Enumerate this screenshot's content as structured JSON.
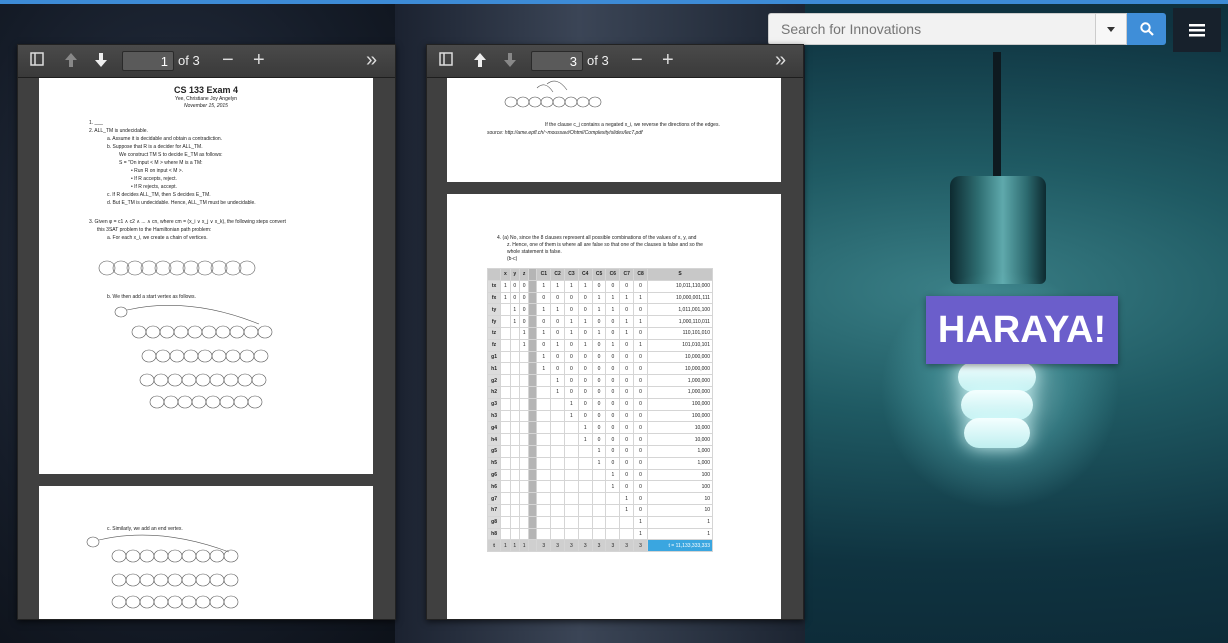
{
  "search": {
    "placeholder": "Search for Innovations"
  },
  "logo": {
    "text": "HARAYA!"
  },
  "viewer_left": {
    "page": "1",
    "of": "of 3"
  },
  "viewer_right": {
    "page": "3",
    "of": "of 3"
  },
  "doc_p1": {
    "title": "CS 133 Exam 4",
    "author": "Yee, Christiane Joy Angelyn",
    "date": "November 15, 2015",
    "lines": [
      "1.  ___",
      "2.  ALL_TM is undecidable.",
      "a.  Assume it is decidable and obtain a contradiction.",
      "b.  Suppose that R is a decider for  ALL_TM.",
      "We construct TM S to decide E_TM as follows:",
      "S = \"On input < M > where M is a TM:",
      "•  Run R on input < M >.",
      "•  If R accepts, reject.",
      "•  If R rejects, accept.",
      "c.  If R decides ALL_TM, then S decides E_TM.",
      "d.  But E_TM is undecidable. Hence, ALL_TM must be undecidable.",
      "3.  Given φ = c1 ∧ c2 ∧ ... ∧ cn, where cm = (x_i ∨ x_j ∨ x_k), the following steps convert",
      "this 3SAT problem to the Hamiltonian path problem:",
      "a.  For each x_i, we create a chain of vertices.",
      "b.  We then add a start vertex as follows."
    ],
    "p2_line": "c.  Similarly, we add an end vertex."
  },
  "doc_p3": {
    "caption": "If the clause c_j contains a negated x_i, we reverse the directions of the edges.",
    "source": "source: http://ame.epfl.ch/~moussavi/Ohtml/Complexity/slides/lec7.pdf",
    "q4": [
      "4.  (a) No, since the 8 clauses represent all possible combinations of the values of x, y, and",
      "z. Hence, one of them is where all are false so that one of the clauses is false and so the",
      "whole statement is false.",
      "(b-c)"
    ],
    "table": {
      "headers": [
        "x",
        "y",
        "z",
        "",
        "C1",
        "C2",
        "C3",
        "C4",
        "C5",
        "C6",
        "C7",
        "C8",
        "S"
      ],
      "rows": [
        [
          "tx",
          "1",
          "0",
          "0",
          "",
          "1",
          "1",
          "1",
          "1",
          "0",
          "0",
          "0",
          "0",
          "10,011,110,000"
        ],
        [
          "fx",
          "1",
          "0",
          "0",
          "",
          "0",
          "0",
          "0",
          "0",
          "1",
          "1",
          "1",
          "1",
          "10,000,001,111"
        ],
        [
          "ty",
          "",
          "1",
          "0",
          "",
          "1",
          "1",
          "0",
          "0",
          "1",
          "1",
          "0",
          "0",
          "1,011,001,100"
        ],
        [
          "fy",
          "",
          "1",
          "0",
          "",
          "0",
          "0",
          "1",
          "1",
          "0",
          "0",
          "1",
          "1",
          "1,000,110,011"
        ],
        [
          "tz",
          "",
          "",
          "1",
          "",
          "1",
          "0",
          "1",
          "0",
          "1",
          "0",
          "1",
          "0",
          "110,101,010"
        ],
        [
          "fz",
          "",
          "",
          "1",
          "",
          "0",
          "1",
          "0",
          "1",
          "0",
          "1",
          "0",
          "1",
          "101,010,101"
        ],
        [
          "g1",
          "",
          "",
          "",
          "",
          "1",
          "0",
          "0",
          "0",
          "0",
          "0",
          "0",
          "0",
          "10,000,000"
        ],
        [
          "h1",
          "",
          "",
          "",
          "",
          "1",
          "0",
          "0",
          "0",
          "0",
          "0",
          "0",
          "0",
          "10,000,000"
        ],
        [
          "g2",
          "",
          "",
          "",
          "",
          "",
          "1",
          "0",
          "0",
          "0",
          "0",
          "0",
          "0",
          "1,000,000"
        ],
        [
          "h2",
          "",
          "",
          "",
          "",
          "",
          "1",
          "0",
          "0",
          "0",
          "0",
          "0",
          "0",
          "1,000,000"
        ],
        [
          "g3",
          "",
          "",
          "",
          "",
          "",
          "",
          "1",
          "0",
          "0",
          "0",
          "0",
          "0",
          "100,000"
        ],
        [
          "h3",
          "",
          "",
          "",
          "",
          "",
          "",
          "1",
          "0",
          "0",
          "0",
          "0",
          "0",
          "100,000"
        ],
        [
          "g4",
          "",
          "",
          "",
          "",
          "",
          "",
          "",
          "1",
          "0",
          "0",
          "0",
          "0",
          "10,000"
        ],
        [
          "h4",
          "",
          "",
          "",
          "",
          "",
          "",
          "",
          "1",
          "0",
          "0",
          "0",
          "0",
          "10,000"
        ],
        [
          "g5",
          "",
          "",
          "",
          "",
          "",
          "",
          "",
          "",
          "1",
          "0",
          "0",
          "0",
          "1,000"
        ],
        [
          "h5",
          "",
          "",
          "",
          "",
          "",
          "",
          "",
          "",
          "1",
          "0",
          "0",
          "0",
          "1,000"
        ],
        [
          "g6",
          "",
          "",
          "",
          "",
          "",
          "",
          "",
          "",
          "",
          "1",
          "0",
          "0",
          "100"
        ],
        [
          "h6",
          "",
          "",
          "",
          "",
          "",
          "",
          "",
          "",
          "",
          "1",
          "0",
          "0",
          "100"
        ],
        [
          "g7",
          "",
          "",
          "",
          "",
          "",
          "",
          "",
          "",
          "",
          "",
          "1",
          "0",
          "10"
        ],
        [
          "h7",
          "",
          "",
          "",
          "",
          "",
          "",
          "",
          "",
          "",
          "",
          "1",
          "0",
          "10"
        ],
        [
          "g8",
          "",
          "",
          "",
          "",
          "",
          "",
          "",
          "",
          "",
          "",
          "",
          "1",
          "1"
        ],
        [
          "h8",
          "",
          "",
          "",
          "",
          "",
          "",
          "",
          "",
          "",
          "",
          "",
          "1",
          "1"
        ],
        [
          "t",
          "1",
          "1",
          "1",
          "",
          "3",
          "3",
          "3",
          "3",
          "3",
          "3",
          "3",
          "3",
          "t = 11,133,333,333"
        ]
      ]
    }
  }
}
